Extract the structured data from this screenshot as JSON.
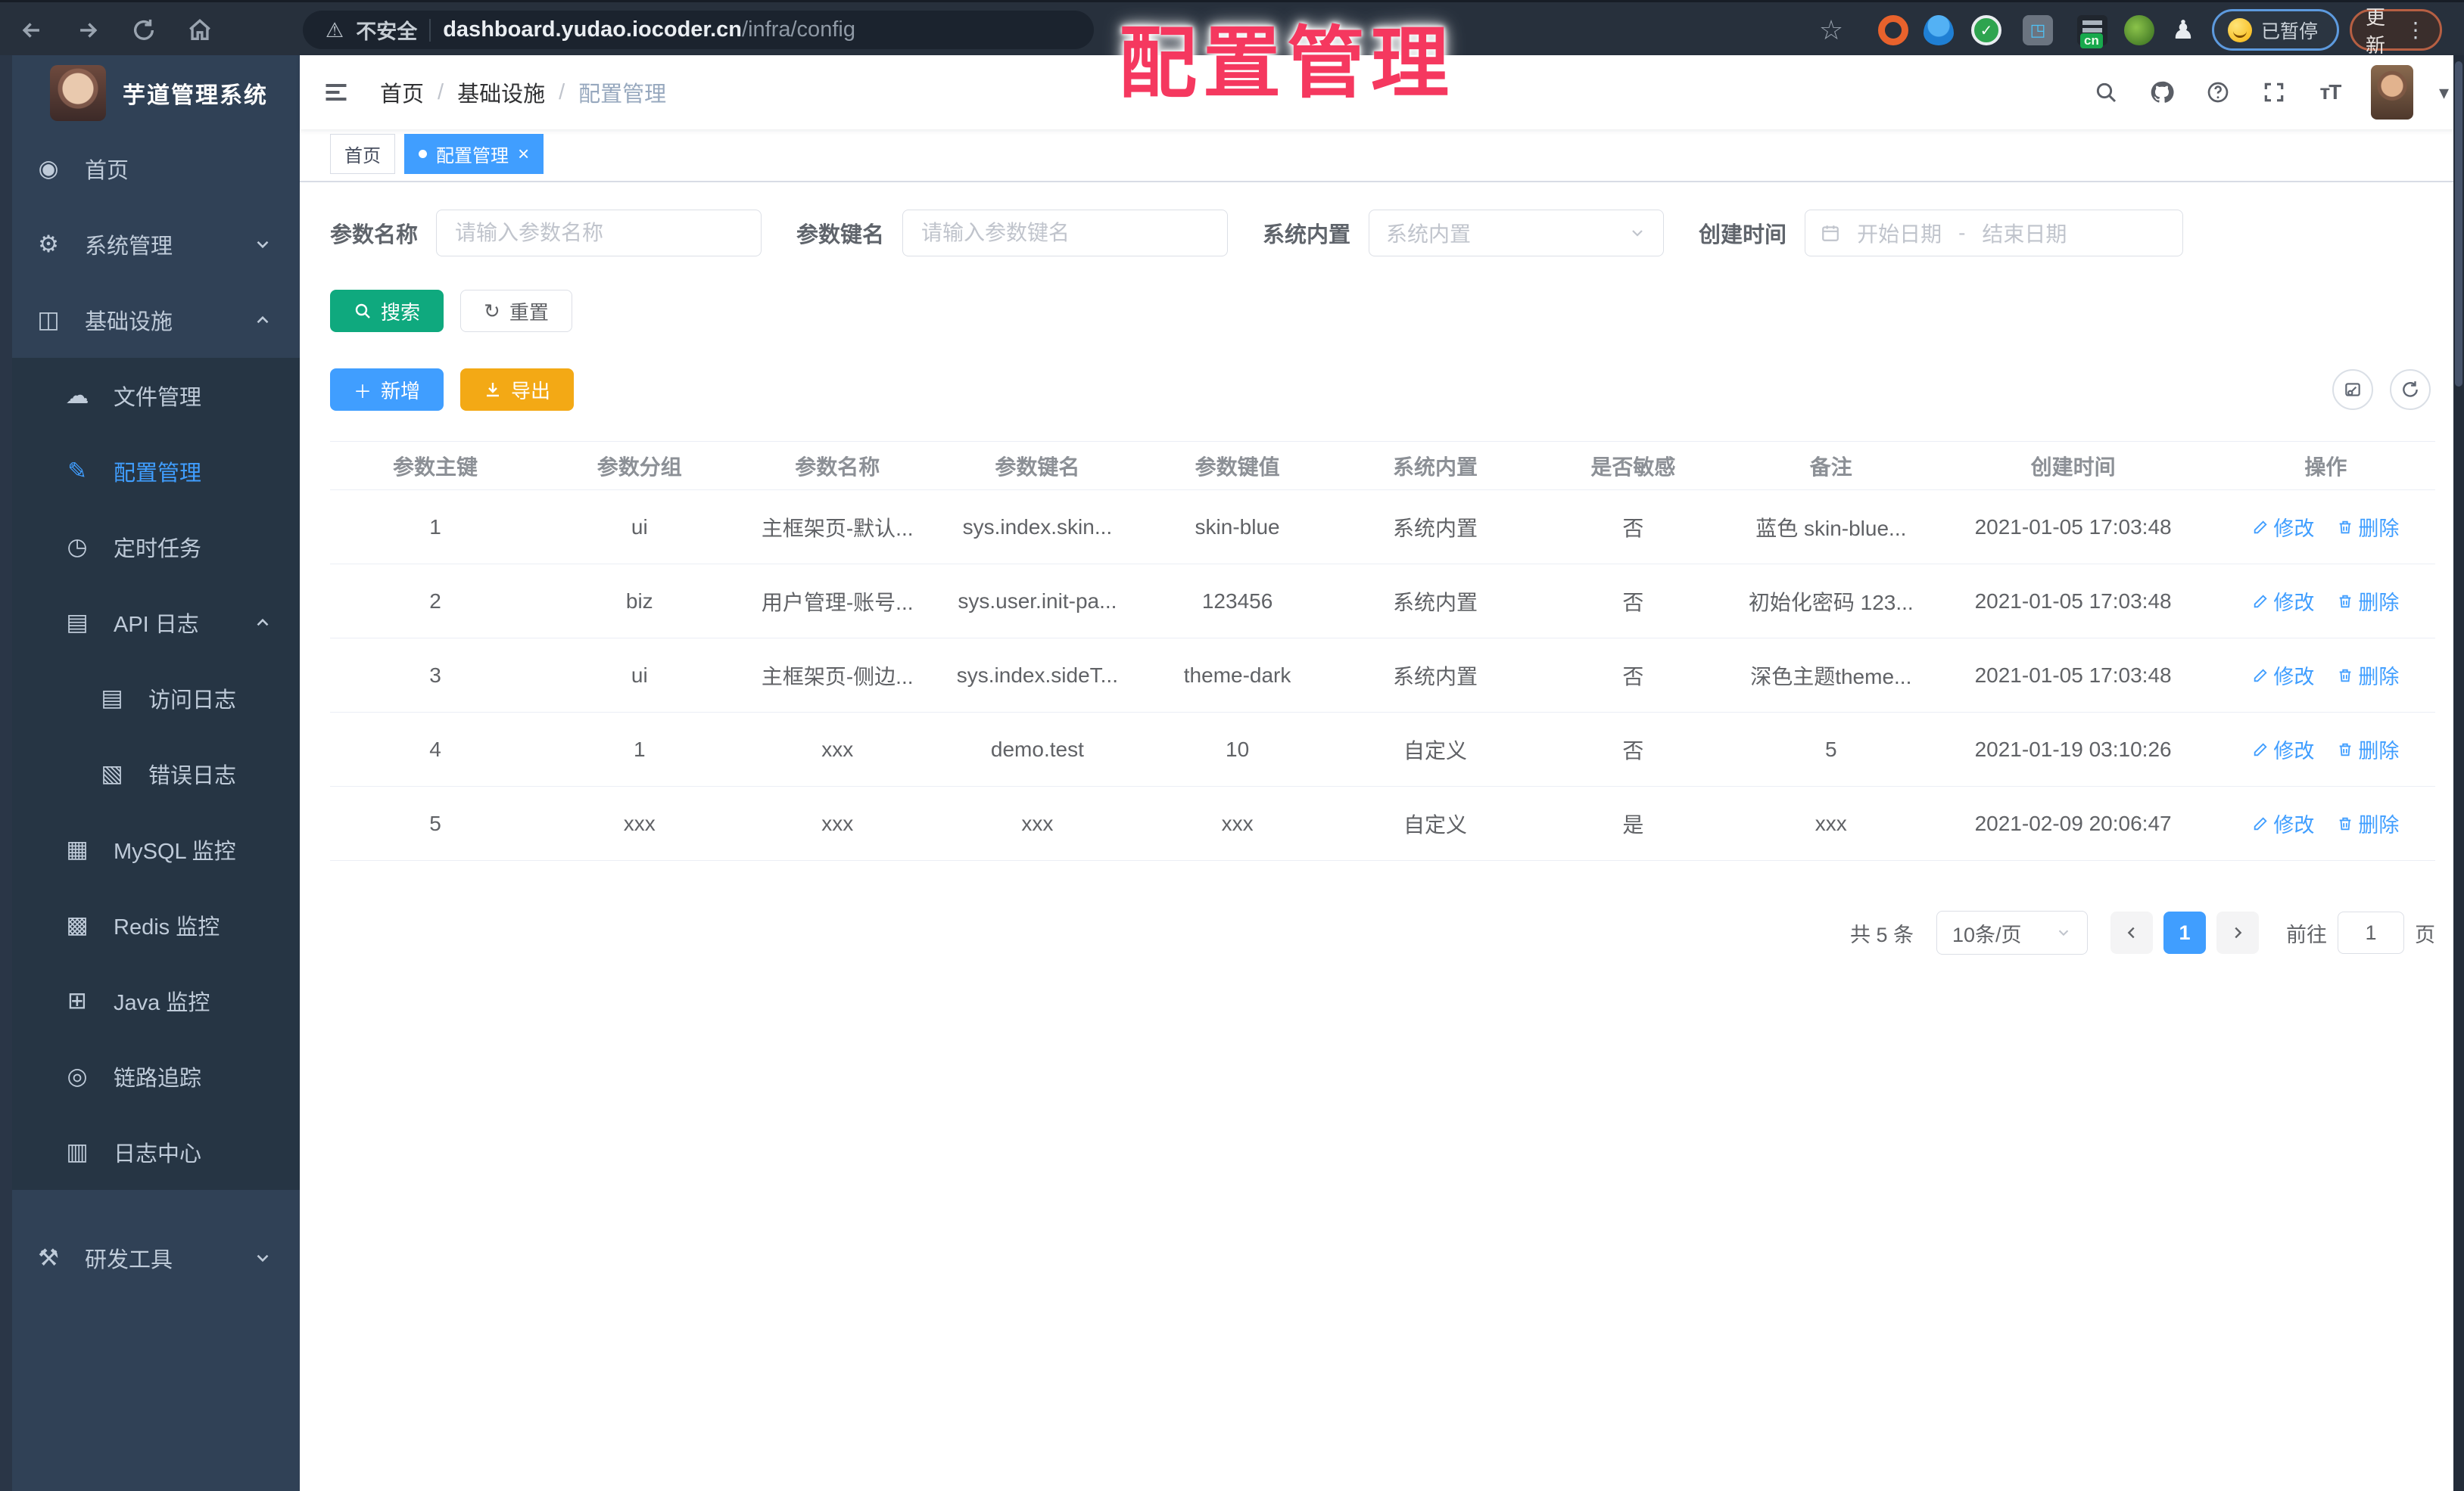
{
  "browser": {
    "security_label": "不安全",
    "url_host": "dashboard.yudao.iocoder.cn",
    "url_path": "/infra/config",
    "paused_label": "已暂停",
    "update_label": "更新"
  },
  "annotation": {
    "title": "配置管理"
  },
  "colors": {
    "accent": "#409eff",
    "search_green": "#0fa97e",
    "export_orange": "#f3a915",
    "annotation_red": "#f5385f",
    "sidebar_bg": "#304156"
  },
  "sidebar": {
    "app_title": "芋道管理系统",
    "items": [
      {
        "label": "首页",
        "glyph": "◉"
      },
      {
        "label": "系统管理",
        "glyph": "⚙"
      },
      {
        "label": "基础设施",
        "glyph": "◫"
      },
      {
        "label": "文件管理",
        "glyph": "☁"
      },
      {
        "label": "配置管理",
        "glyph": "✎"
      },
      {
        "label": "定时任务",
        "glyph": "◷"
      },
      {
        "label": "API 日志",
        "glyph": "▤"
      },
      {
        "label": "访问日志",
        "glyph": "▤"
      },
      {
        "label": "错误日志",
        "glyph": "▧"
      },
      {
        "label": "MySQL 监控",
        "glyph": "▦"
      },
      {
        "label": "Redis 监控",
        "glyph": "▩"
      },
      {
        "label": "Java 监控",
        "glyph": "⊞"
      },
      {
        "label": "链路追踪",
        "glyph": "◎"
      },
      {
        "label": "日志中心",
        "glyph": "▥"
      },
      {
        "label": "研发工具",
        "glyph": "⚒"
      }
    ]
  },
  "header": {
    "breadcrumb": [
      "首页",
      "基础设施",
      "配置管理"
    ]
  },
  "tabs": [
    {
      "label": "首页"
    },
    {
      "label": "配置管理"
    }
  ],
  "filters": {
    "name": {
      "label": "参数名称",
      "placeholder": "请输入参数名称"
    },
    "key": {
      "label": "参数键名",
      "placeholder": "请输入参数键名"
    },
    "builtin": {
      "label": "系统内置",
      "placeholder": "系统内置"
    },
    "time": {
      "label": "创建时间",
      "start_placeholder": "开始日期",
      "separator": "-",
      "end_placeholder": "结束日期"
    }
  },
  "actions": {
    "search": "搜索",
    "reset": "重置",
    "add": "新增",
    "export": "导出"
  },
  "table": {
    "headers": [
      "参数主键",
      "参数分组",
      "参数名称",
      "参数键名",
      "参数键值",
      "系统内置",
      "是否敏感",
      "备注",
      "创建时间",
      "操作"
    ],
    "edit_label": "修改",
    "delete_label": "删除",
    "rows": [
      [
        "1",
        "ui",
        "主框架页-默认...",
        "sys.index.skin...",
        "skin-blue",
        "系统内置",
        "否",
        "蓝色 skin-blue...",
        "2021-01-05 17:03:48"
      ],
      [
        "2",
        "biz",
        "用户管理-账号...",
        "sys.user.init-pa...",
        "123456",
        "系统内置",
        "否",
        "初始化密码 123...",
        "2021-01-05 17:03:48"
      ],
      [
        "3",
        "ui",
        "主框架页-侧边...",
        "sys.index.sideT...",
        "theme-dark",
        "系统内置",
        "否",
        "深色主题theme...",
        "2021-01-05 17:03:48"
      ],
      [
        "4",
        "1",
        "xxx",
        "demo.test",
        "10",
        "自定义",
        "否",
        "5",
        "2021-01-19 03:10:26"
      ],
      [
        "5",
        "xxx",
        "xxx",
        "xxx",
        "xxx",
        "自定义",
        "是",
        "xxx",
        "2021-02-09 20:06:47"
      ]
    ]
  },
  "pagination": {
    "total": "共 5 条",
    "page_size": "10条/页",
    "current": "1",
    "goto_label": "前往",
    "goto_value": "1",
    "page_unit": "页"
  }
}
